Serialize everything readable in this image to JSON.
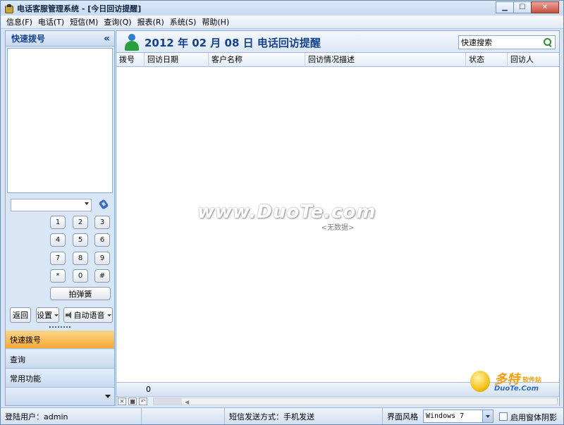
{
  "window": {
    "title": "电话客服管理系统 - [今日回访提醒]",
    "controls": {
      "minimize": "▁",
      "maximize": "☐",
      "close": "✕"
    }
  },
  "menu": [
    {
      "label": "信息(F)"
    },
    {
      "label": "电话(T)"
    },
    {
      "label": "短信(M)"
    },
    {
      "label": "查询(Q)"
    },
    {
      "label": "报表(R)"
    },
    {
      "label": "系统(S)"
    },
    {
      "label": "帮助(H)"
    }
  ],
  "left_panel": {
    "title": "快速拨号",
    "collapse_glyph": "«",
    "keypad": [
      "1",
      "2",
      "3",
      "4",
      "5",
      "6",
      "7",
      "8",
      "9",
      "*",
      "0",
      "#"
    ],
    "flash_key": "拍弹簧",
    "buttons": {
      "back": "返回",
      "settings": "设置",
      "auto_voice": "自动语音"
    },
    "nav": [
      "快速拨号",
      "查询",
      "常用功能"
    ]
  },
  "main": {
    "header_title": "2012 年 02 月 08 日  电话回访提醒",
    "search_value": "快速搜索",
    "columns": [
      "拨号",
      "回访日期",
      "客户名称",
      "回访情况描述",
      "状态",
      "回访人"
    ],
    "empty_text": "<无数据>",
    "watermark": "www.DuoTe.com",
    "footer_count": "0"
  },
  "brand": {
    "name": "多特",
    "suffix": "软件站",
    "site": "DuoTe.Com"
  },
  "status": {
    "user": "登陆用户：admin",
    "sms_mode": "短信发送方式：手机发送",
    "style_label": "界面风格",
    "style_value": "Windows 7",
    "shadow_label": "启用窗体阴影"
  },
  "colors": {
    "accent": "#15428b",
    "active_nav": "#f6a934",
    "panel_bg": "#d6e4f5"
  }
}
